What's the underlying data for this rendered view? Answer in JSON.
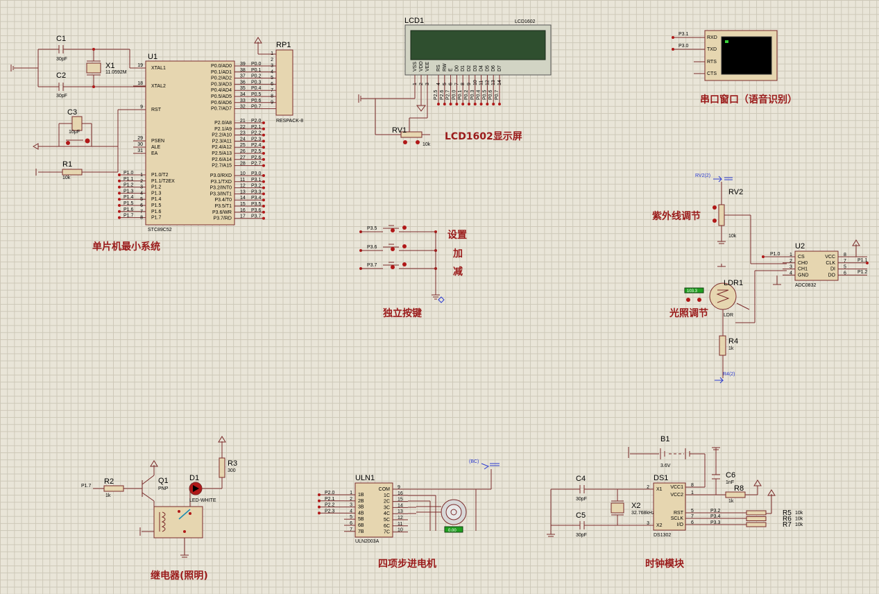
{
  "colors": {
    "wire": "#7a2a2a",
    "body": "#e6d6b0",
    "label": "#9a1a1a",
    "dot": "#b01818"
  },
  "sections": {
    "mcu": "单片机最小系统",
    "lcd": "LCD1602显示屏",
    "serial": "串口窗口（语音识别）",
    "keys": "独立按键",
    "key_set": "设置",
    "key_add": "加",
    "key_sub": "减",
    "uv": "紫外线调节",
    "light": "光照调节",
    "relay": "继电器(照明)",
    "stepper": "四项步进电机",
    "clock": "时钟模块"
  },
  "mcu": {
    "ref": "U1",
    "part": "STC89C52",
    "left_pins": [
      {
        "num": "19",
        "name": "XTAL1"
      },
      {
        "num": "18",
        "name": "XTAL2"
      },
      {
        "num": "9",
        "name": "RST"
      },
      {
        "num": "29",
        "name": "PSEN"
      },
      {
        "num": "30",
        "name": "ALE"
      },
      {
        "num": "31",
        "name": "EA"
      }
    ],
    "p1_pins": [
      {
        "num": "1",
        "name": "P1.0/T2",
        "net": "P1.0"
      },
      {
        "num": "2",
        "name": "P1.1/T2EX",
        "net": "P1.1"
      },
      {
        "num": "3",
        "name": "P1.2",
        "net": "P1.2"
      },
      {
        "num": "4",
        "name": "P1.3",
        "net": "P1.3"
      },
      {
        "num": "5",
        "name": "P1.4",
        "net": "P1.4"
      },
      {
        "num": "6",
        "name": "P1.5",
        "net": "P1.5"
      },
      {
        "num": "7",
        "name": "P1.6",
        "net": "P1.6"
      },
      {
        "num": "8",
        "name": "P1.7",
        "net": "P1.7"
      }
    ],
    "p0_pins": [
      {
        "num": "39",
        "name": "P0.0/AD0",
        "net": "P0.0"
      },
      {
        "num": "38",
        "name": "P0.1/AD1",
        "net": "P0.1"
      },
      {
        "num": "37",
        "name": "P0.2/AD2",
        "net": "P0.2"
      },
      {
        "num": "36",
        "name": "P0.3/AD3",
        "net": "P0.3"
      },
      {
        "num": "35",
        "name": "P0.4/AD4",
        "net": "P0.4"
      },
      {
        "num": "34",
        "name": "P0.5/AD5",
        "net": "P0.5"
      },
      {
        "num": "33",
        "name": "P0.6/AD6",
        "net": "P0.6"
      },
      {
        "num": "32",
        "name": "P0.7/AD7",
        "net": "P0.7"
      }
    ],
    "p2_pins": [
      {
        "num": "21",
        "name": "P2.0/A8",
        "net": "P2.0"
      },
      {
        "num": "22",
        "name": "P2.1/A9",
        "net": "P2.1"
      },
      {
        "num": "23",
        "name": "P2.2/A10",
        "net": "P2.2"
      },
      {
        "num": "24",
        "name": "P2.3/A11",
        "net": "P2.3"
      },
      {
        "num": "25",
        "name": "P2.4/A12",
        "net": "P2.4"
      },
      {
        "num": "26",
        "name": "P2.5/A13",
        "net": "P2.5"
      },
      {
        "num": "27",
        "name": "P2.6/A14",
        "net": "P2.6"
      },
      {
        "num": "28",
        "name": "P2.7/A15",
        "net": "P2.7"
      }
    ],
    "p3_pins": [
      {
        "num": "10",
        "name": "P3.0/RXD",
        "net": "P3.0"
      },
      {
        "num": "11",
        "name": "P3.1/TXD",
        "net": "P3.1"
      },
      {
        "num": "12",
        "name": "P3.2/INT0",
        "net": "P3.2"
      },
      {
        "num": "13",
        "name": "P3.3/INT1",
        "net": "P3.3"
      },
      {
        "num": "14",
        "name": "P3.4/T0",
        "net": "P3.4"
      },
      {
        "num": "15",
        "name": "P3.5/T1",
        "net": "P3.5"
      },
      {
        "num": "16",
        "name": "P3.6/WR",
        "net": "P3.6"
      },
      {
        "num": "17",
        "name": "P3.7/RD",
        "net": "P3.7"
      }
    ]
  },
  "parts": {
    "c1": {
      "ref": "C1",
      "val": "30pF"
    },
    "c2": {
      "ref": "C2",
      "val": "30pF"
    },
    "x1": {
      "ref": "X1",
      "val": "11.0592M"
    },
    "c3": {
      "ref": "C3",
      "val": "10μF"
    },
    "r1": {
      "ref": "R1",
      "val": "10k"
    },
    "rp1": {
      "ref": "RP1",
      "val": "RESPACK-8",
      "pins": [
        "1",
        "2",
        "3",
        "4",
        "5",
        "6",
        "7",
        "8",
        "9"
      ]
    },
    "lcd1": {
      "ref": "LCD1",
      "val": "LCD1602",
      "pins": [
        "VSS",
        "VDD",
        "VEE",
        "RS",
        "RW",
        "E",
        "D0",
        "D1",
        "D2",
        "D3",
        "D4",
        "D5",
        "D6",
        "D7"
      ],
      "nums": [
        "1",
        "2",
        "3",
        "4",
        "5",
        "6",
        "7",
        "8",
        "9",
        "10",
        "11",
        "12",
        "13",
        "14"
      ],
      "nets": [
        "P2.5",
        "P2.6",
        "P2.7",
        "P0.0",
        "P0.1",
        "P0.2",
        "P0.3",
        "P0.4",
        "P0.5",
        "P0.6",
        "P0.7"
      ]
    },
    "rv1": {
      "ref": "RV1",
      "val": "10k"
    },
    "vt": {
      "pins": [
        "RXD",
        "TXD",
        "RTS",
        "CTS"
      ],
      "nets": [
        "P3.1",
        "P3.0"
      ]
    },
    "keys": {
      "nets": [
        "P3.5",
        "P3.6",
        "P3.7"
      ]
    },
    "rv2": {
      "ref": "RV2",
      "val": "10k",
      "net": "RV2(2)"
    },
    "u2": {
      "ref": "U2",
      "val": "ADC0832",
      "left": [
        {
          "num": "1",
          "name": "CS"
        },
        {
          "num": "2",
          "name": "CH0"
        },
        {
          "num": "3",
          "name": "CH1"
        },
        {
          "num": "4",
          "name": "GND"
        }
      ],
      "right": [
        {
          "num": "8",
          "name": "VCC"
        },
        {
          "num": "7",
          "name": "CLK"
        },
        {
          "num": "5",
          "name": "DI"
        },
        {
          "num": "6",
          "name": "DO"
        }
      ],
      "nets": [
        "P1.0",
        "P1.1",
        "P1.2"
      ]
    },
    "ldr1": {
      "ref": "LDR1",
      "val": "LDR",
      "reading": "103.3"
    },
    "r4": {
      "ref": "R4",
      "val": "1k",
      "net": "R4(2)"
    },
    "r2": {
      "ref": "R2",
      "val": "1k",
      "net": "P1.7"
    },
    "q1": {
      "ref": "Q1",
      "val": "PNP"
    },
    "d1": {
      "ref": "D1",
      "val": "LED-WHITE"
    },
    "r3": {
      "ref": "R3",
      "val": "300"
    },
    "uln1": {
      "ref": "ULN1",
      "val": "ULN2003A",
      "left": [
        {
          "num": "1",
          "name": "1B"
        },
        {
          "num": "2",
          "name": "2B"
        },
        {
          "num": "3",
          "name": "3B"
        },
        {
          "num": "4",
          "name": "4B"
        },
        {
          "num": "5",
          "name": "5B"
        },
        {
          "num": "6",
          "name": "6B"
        },
        {
          "num": "7",
          "name": "7B"
        }
      ],
      "right": [
        {
          "num": "9",
          "name": "COM"
        },
        {
          "num": "16",
          "name": "1C"
        },
        {
          "num": "15",
          "name": "2C"
        },
        {
          "num": "14",
          "name": "3C"
        },
        {
          "num": "13",
          "name": "4C"
        },
        {
          "num": "12",
          "name": "5C"
        },
        {
          "num": "11",
          "name": "6C"
        },
        {
          "num": "10",
          "name": "7C"
        }
      ],
      "nets": [
        "P2.0",
        "P2.1",
        "P2.2",
        "P2.3"
      ],
      "bc": "(BC)",
      "motor_reading": "0.00"
    },
    "b1": {
      "ref": "B1",
      "val": "3.6V"
    },
    "c6": {
      "ref": "C6",
      "val": "1nF"
    },
    "r8": {
      "ref": "R8",
      "val": "1k"
    },
    "c4": {
      "ref": "C4",
      "val": "30pF"
    },
    "c5": {
      "ref": "C5",
      "val": "30pF"
    },
    "x2": {
      "ref": "X2",
      "val": "32.768kHz"
    },
    "ds1": {
      "ref": "DS1",
      "val": "DS1302",
      "left": [
        {
          "num": "2",
          "name": "X1"
        },
        {
          "num": "3",
          "name": "X2"
        }
      ],
      "right": [
        {
          "num": "8",
          "name": "VCC1"
        },
        {
          "num": "1",
          "name": "VCC2"
        },
        {
          "num": "5",
          "name": "RST"
        },
        {
          "num": "7",
          "name": "SCLK"
        },
        {
          "num": "6",
          "name": "I/O"
        }
      ],
      "nets": [
        "P3.2",
        "P3.4",
        "P3.3"
      ]
    },
    "r5": {
      "ref": "R5",
      "val": "10k"
    },
    "r6": {
      "ref": "R6",
      "val": "10k"
    },
    "r7": {
      "ref": "R7",
      "val": "10k"
    }
  }
}
